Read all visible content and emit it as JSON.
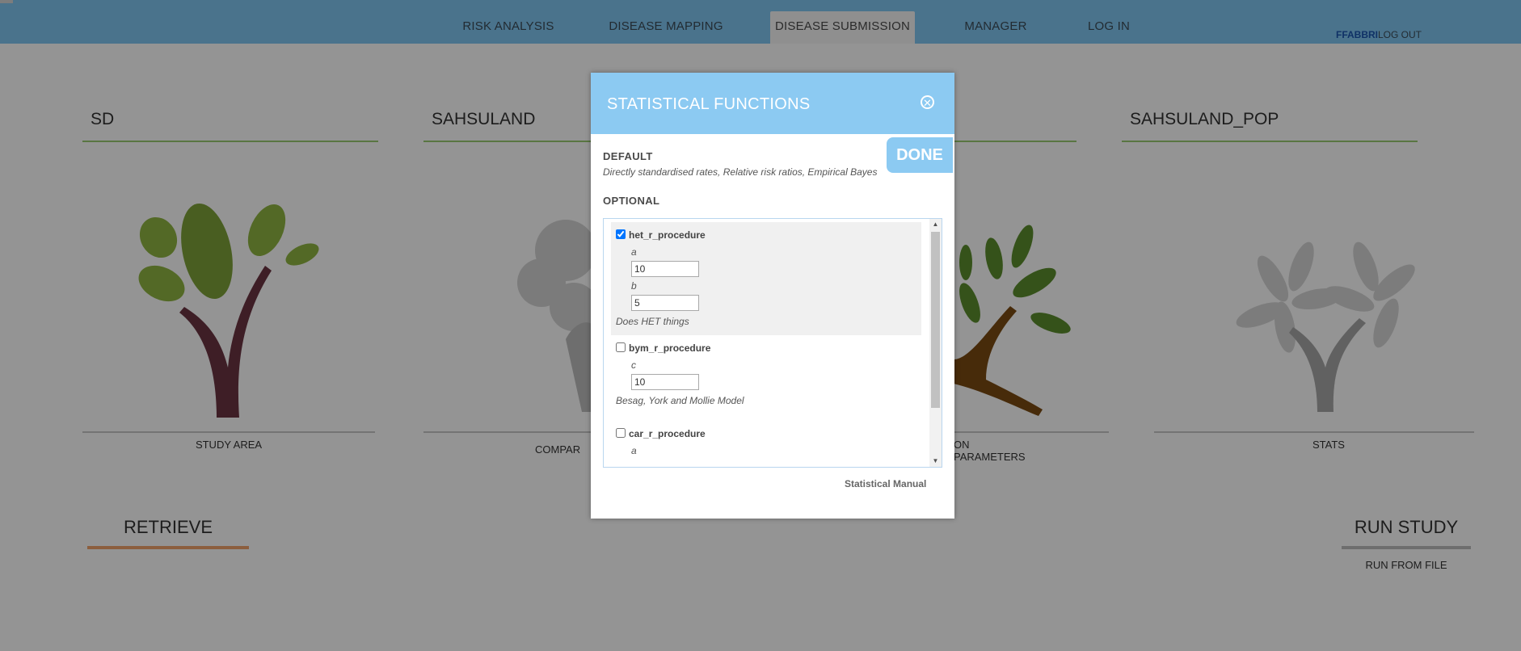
{
  "nav": {
    "tabs": [
      {
        "label": "RISK ANALYSIS"
      },
      {
        "label": "DISEASE MAPPING"
      },
      {
        "label": "DISEASE SUBMISSION",
        "active": true
      },
      {
        "label": "MANAGER"
      },
      {
        "label": "LOG IN"
      }
    ],
    "user": "FFABBRI",
    "logout": "LOG OUT"
  },
  "columns": [
    {
      "title": "SD",
      "caption": "STUDY AREA",
      "icon": "study-area-tree-icon"
    },
    {
      "title": "SAHSULAND",
      "caption": "COMPAR",
      "icon": "comparison-area-tree-icon"
    },
    {
      "title": "",
      "caption": "ON PARAMETERS",
      "icon": "investigation-parameters-tree-icon"
    },
    {
      "title": "SAHSULAND_POP",
      "caption": "STATS",
      "icon": "stats-tree-icon"
    }
  ],
  "bottom": {
    "retrieve": "RETRIEVE",
    "run_study": "RUN STUDY",
    "run_from_file": "RUN FROM FILE"
  },
  "modal": {
    "title": "STATISTICAL FUNCTIONS",
    "done": "DONE",
    "default_label": "DEFAULT",
    "default_desc": "Directly standardised rates, Relative risk ratios, Empirical Bayes",
    "optional_label": "OPTIONAL",
    "procedures": [
      {
        "name": "het_r_procedure",
        "checked": true,
        "params": [
          {
            "label": "a",
            "value": "10"
          },
          {
            "label": "b",
            "value": "5"
          }
        ],
        "desc": "Does HET things"
      },
      {
        "name": "bym_r_procedure",
        "checked": false,
        "params": [
          {
            "label": "c",
            "value": "10"
          }
        ],
        "desc": "Besag, York and Mollie Model"
      },
      {
        "name": "car_r_procedure",
        "checked": false,
        "params": [
          {
            "label": "a",
            "value": ""
          }
        ],
        "desc": ""
      }
    ],
    "manual_link": "Statistical Manual"
  },
  "colors": {
    "nav_bar": "#80c7f2",
    "modal_header": "#8ccaf2",
    "retrieve_underline": "#f2a36c",
    "column_title_underline": "#9acb73"
  }
}
